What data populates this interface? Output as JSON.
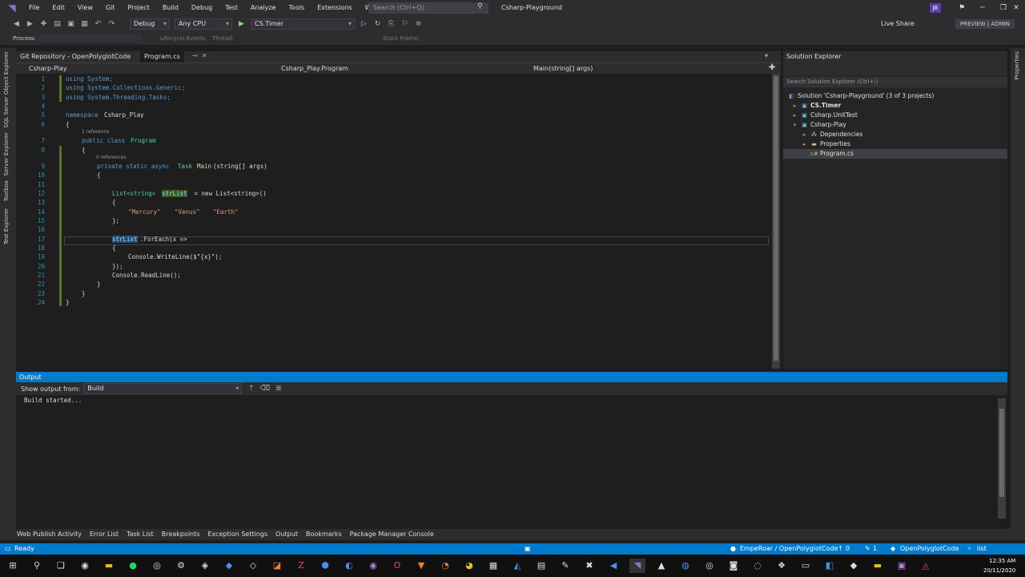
{
  "menu": [
    "File",
    "Edit",
    "View",
    "Git",
    "Project",
    "Build",
    "Debug",
    "Test",
    "Analyze",
    "Tools",
    "Extensions",
    "Window",
    "Help"
  ],
  "search_placeholder": "Search (Ctrl+Q)",
  "solution_title": "Csharp-Playground",
  "user_initials": "JB",
  "toolbar": {
    "config": "Debug",
    "platform": "Any CPU",
    "startup": "CS.Timer",
    "live_share": "Live Share",
    "preview": "PREVIEW | ADMIN"
  },
  "process": {
    "label": "Process:",
    "lifecycle": "Lifecycle Events",
    "thread": "Thread:",
    "stackframe": "Stack Frame:"
  },
  "left_tabs": [
    "SQL Server Object Explorer",
    "Server Explorer",
    "Toolbox",
    "Test Explorer"
  ],
  "right_tabs": [
    "Properties"
  ],
  "editor_tabs": [
    "Git Repository - OpenPolyglotCode",
    "Program.cs"
  ],
  "nav": {
    "project": "Csharp-Play",
    "class": "Csharp_Play.Program",
    "member": "Main(string[] args)"
  },
  "code": {
    "l1": "using System;",
    "l2": "using System.Collections.Generic;",
    "l3": "using System.Threading.Tasks;",
    "l5_kw": "namespace",
    "l5_name": "Csharp_Play",
    "ref1": "1 reference",
    "l7_kw": "public class",
    "l7_name": "Program",
    "ref0": "0 references",
    "l9_kw": "private static async",
    "l9_type": "Task",
    "l9_fn": "Main",
    "l9_rest": "(string[] args)",
    "l12_type": "List<string>",
    "l12_var": "strList",
    "l12_rest": " = new List<string>()",
    "l14_s1": "\"Mercury\"",
    "l14_s2": "\"Venus\"",
    "l14_s3": "\"Earth\"",
    "l15": "};",
    "l17_var": "strList",
    "l17_rest": ".ForEach(x =>",
    "l19": "Console.WriteLine($\"{x}\");",
    "l20": "});",
    "l21": "Console.ReadLine();",
    "brace_open": "{",
    "brace_close": "}"
  },
  "line_numbers": [
    "1",
    "2",
    "3",
    "4",
    "5",
    "6",
    "7",
    "8",
    "9",
    "10",
    "11",
    "12",
    "13",
    "14",
    "15",
    "16",
    "17",
    "18",
    "19",
    "20",
    "21",
    "22",
    "23",
    "24"
  ],
  "solution_explorer": {
    "title": "Solution Explorer",
    "search": "Search Solution Explorer (Ctrl+;)",
    "items": [
      "Solution 'Csharp-Playground' (3 of 3 projects)",
      "CS.Timer",
      "Csharp.UnitTest",
      "Csharp-Play",
      "Dependencies",
      "Properties",
      "Program.cs"
    ]
  },
  "output": {
    "title": "Output",
    "show_from_label": "Show output from:",
    "source": "Build",
    "text": "Build started..."
  },
  "bottom_tabs": [
    "Web Publish Activity",
    "Error List",
    "Task List",
    "Breakpoints",
    "Exception Settings",
    "Output",
    "Bookmarks",
    "Package Manager Console"
  ],
  "status": {
    "ready": "Ready",
    "repo": "EmpeRoar / OpenPolyglotCode",
    "up": "0",
    "changes": "1",
    "branch_repo": "OpenPolyglotCode",
    "branch": "list"
  },
  "clock": {
    "time": "12:35 AM",
    "date": "20/11/2020"
  },
  "colors": {
    "accent": "#007acc",
    "background": "#1e1e1e",
    "keyword": "#569cd6",
    "type": "#4ec9b0",
    "string": "#d69d85"
  }
}
